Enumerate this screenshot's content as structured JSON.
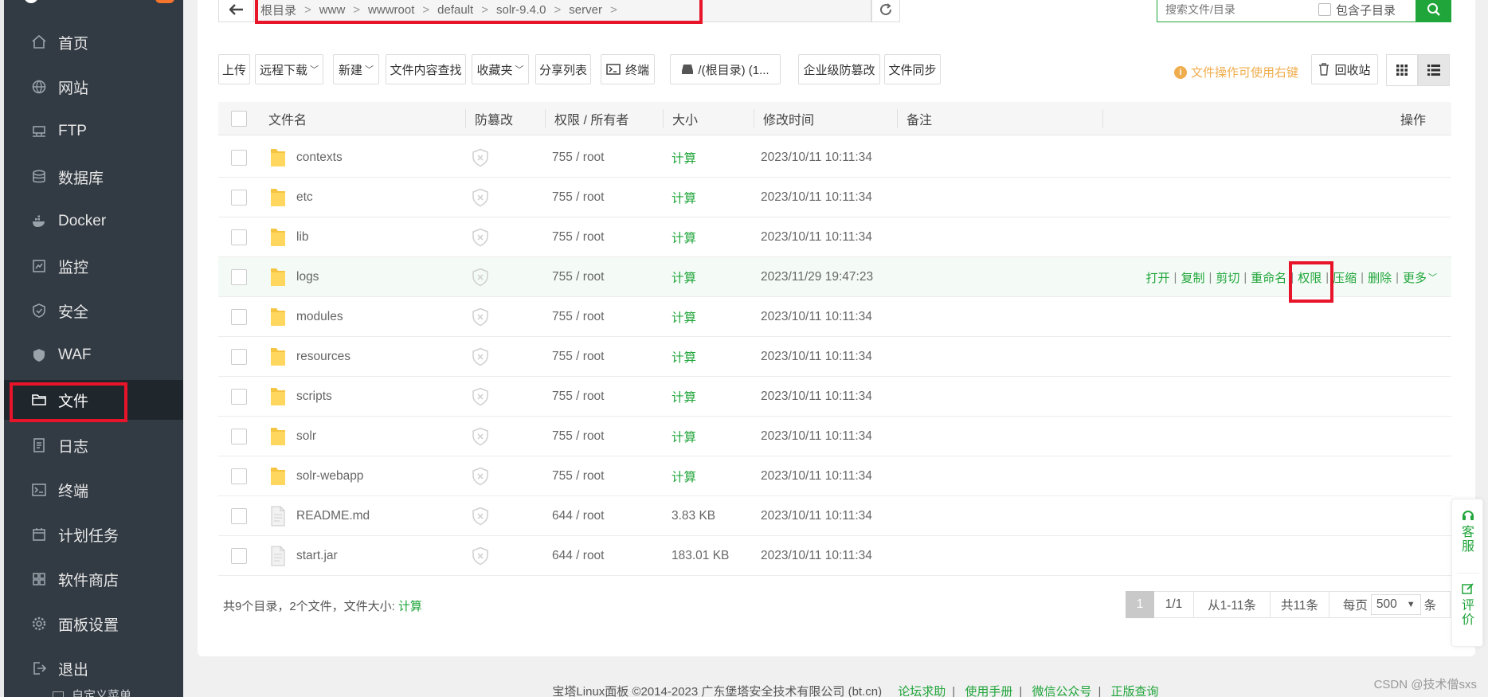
{
  "sidebar": {
    "items": [
      {
        "label": "首页",
        "icon": "home-icon"
      },
      {
        "label": "网站",
        "icon": "globe-icon"
      },
      {
        "label": "FTP",
        "icon": "ftp-icon"
      },
      {
        "label": "数据库",
        "icon": "database-icon"
      },
      {
        "label": "Docker",
        "icon": "docker-icon"
      },
      {
        "label": "监控",
        "icon": "monitor-icon"
      },
      {
        "label": "安全",
        "icon": "shield-icon"
      },
      {
        "label": "WAF",
        "icon": "waf-icon"
      },
      {
        "label": "文件",
        "icon": "folder-icon"
      },
      {
        "label": "日志",
        "icon": "log-icon"
      },
      {
        "label": "终端",
        "icon": "terminal-icon"
      },
      {
        "label": "计划任务",
        "icon": "calendar-icon"
      },
      {
        "label": "软件商店",
        "icon": "apps-icon"
      },
      {
        "label": "面板设置",
        "icon": "gear-icon"
      },
      {
        "label": "退出",
        "icon": "logout-icon"
      }
    ],
    "active_label": "文件",
    "custom_menu_label": "自定义菜单"
  },
  "path": {
    "segments": [
      "根目录",
      "www",
      "wwwroot",
      "default",
      "solr-9.4.0",
      "server"
    ],
    "separator": ">"
  },
  "search": {
    "placeholder": "搜索文件/目录",
    "include_sub_label": "包含子目录"
  },
  "toolbar": {
    "upload": "上传",
    "remote_download": "远程下载",
    "new": "新建",
    "content_search": "文件内容查找",
    "favorites": "收藏夹",
    "share_list": "分享列表",
    "terminal": "终端",
    "disk": "/(根目录) (1...",
    "tamper_proof": "企业级防篡改",
    "file_sync": "文件同步",
    "tip": "文件操作可使用右键",
    "recycle": "回收站"
  },
  "table": {
    "headers": {
      "name": "文件名",
      "protect": "防篡改",
      "perm": "权限 / 所有者",
      "size": "大小",
      "mtime": "修改时间",
      "note": "备注",
      "ops": "操作"
    },
    "rows": [
      {
        "name": "contexts",
        "type": "folder",
        "perm": "755 / root",
        "size": "计算",
        "mtime": "2023/10/11 10:11:34"
      },
      {
        "name": "etc",
        "type": "folder",
        "perm": "755 / root",
        "size": "计算",
        "mtime": "2023/10/11 10:11:34"
      },
      {
        "name": "lib",
        "type": "folder",
        "perm": "755 / root",
        "size": "计算",
        "mtime": "2023/10/11 10:11:34"
      },
      {
        "name": "logs",
        "type": "folder",
        "perm": "755 / root",
        "size": "计算",
        "mtime": "2023/11/29 19:47:23"
      },
      {
        "name": "modules",
        "type": "folder",
        "perm": "755 / root",
        "size": "计算",
        "mtime": "2023/10/11 10:11:34"
      },
      {
        "name": "resources",
        "type": "folder",
        "perm": "755 / root",
        "size": "计算",
        "mtime": "2023/10/11 10:11:34"
      },
      {
        "name": "scripts",
        "type": "folder",
        "perm": "755 / root",
        "size": "计算",
        "mtime": "2023/10/11 10:11:34"
      },
      {
        "name": "solr",
        "type": "folder",
        "perm": "755 / root",
        "size": "计算",
        "mtime": "2023/10/11 10:11:34"
      },
      {
        "name": "solr-webapp",
        "type": "folder",
        "perm": "755 / root",
        "size": "计算",
        "mtime": "2023/10/11 10:11:34"
      },
      {
        "name": "README.md",
        "type": "file",
        "perm": "644 / root",
        "size": "3.83 KB",
        "mtime": "2023/10/11 10:11:34"
      },
      {
        "name": "start.jar",
        "type": "file",
        "perm": "644 / root",
        "size": "183.01 KB",
        "mtime": "2023/10/11 10:11:34"
      }
    ],
    "row_actions": [
      "打开",
      "复制",
      "剪切",
      "重命名",
      "权限",
      "压缩",
      "删除",
      "更多"
    ]
  },
  "summary": {
    "text": "共9个目录，2个文件，文件大小:",
    "calc": "计算"
  },
  "pager": {
    "current": "1",
    "pages": "1/1",
    "range": "从1-11条",
    "total": "共11条",
    "per_page_prefix": "每页",
    "per_page_value": "500",
    "per_page_suffix": "条"
  },
  "float_widget": {
    "service": [
      "客",
      "服"
    ],
    "rate": [
      "评",
      "价"
    ]
  },
  "footer": {
    "copyright": "宝塔Linux面板 ©2014-2023 广东堡塔安全技术有限公司 (bt.cn)",
    "links": [
      "论坛求助",
      "使用手册",
      "微信公众号",
      "正版查询"
    ]
  },
  "watermark": "CSDN @技术僧sxs",
  "colors": {
    "accent": "#20a53a",
    "sidebar_bg": "#323a43",
    "highlight_red": "#e8142a",
    "warning": "#f0ad4e"
  }
}
